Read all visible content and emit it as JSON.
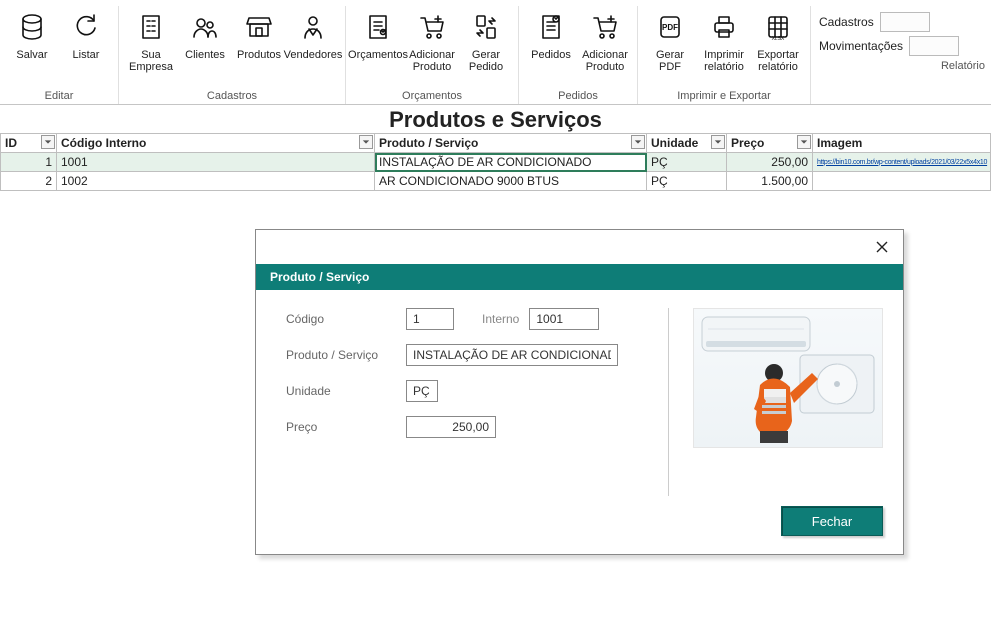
{
  "ribbon": {
    "groups": [
      {
        "label": "Editar",
        "buttons": [
          {
            "name": "salvar-button",
            "icon": "db",
            "label": "Salvar"
          },
          {
            "name": "listar-button",
            "icon": "refresh",
            "label": "Listar"
          }
        ]
      },
      {
        "label": "Cadastros",
        "buttons": [
          {
            "name": "sua-empresa-button",
            "icon": "building",
            "label": "Sua\nEmpresa"
          },
          {
            "name": "clientes-button",
            "icon": "people",
            "label": "Clientes"
          },
          {
            "name": "produtos-button",
            "icon": "store",
            "label": "Produtos"
          },
          {
            "name": "vendedores-button",
            "icon": "vendor",
            "label": "Vendedores"
          }
        ]
      },
      {
        "label": "Orçamentos",
        "buttons": [
          {
            "name": "orcamentos-button",
            "icon": "invoice",
            "label": "Orçamentos"
          },
          {
            "name": "adicionar-produto-orc-button",
            "icon": "cart-add",
            "label": "Adicionar\nProduto"
          },
          {
            "name": "gerar-pedido-button",
            "icon": "swap",
            "label": "Gerar\nPedido"
          }
        ]
      },
      {
        "label": "Pedidos",
        "buttons": [
          {
            "name": "pedidos-button",
            "icon": "order",
            "label": "Pedidos"
          },
          {
            "name": "adicionar-produto-ped-button",
            "icon": "cart-add",
            "label": "Adicionar\nProduto"
          }
        ]
      },
      {
        "label": "Imprimir e Exportar",
        "buttons": [
          {
            "name": "gerar-pdf-button",
            "icon": "pdf",
            "label": "Gerar\nPDF"
          },
          {
            "name": "imprimir-relatorio-button",
            "icon": "printer",
            "label": "Imprimir\nrelatório"
          },
          {
            "name": "exportar-relatorio-button",
            "icon": "xls",
            "label": "Exportar\nrelatório"
          }
        ]
      }
    ],
    "side": {
      "row1_label": "Cadastros",
      "row2_label": "Movimentações",
      "bottom_label": "Relatório"
    }
  },
  "page_title": "Produtos e Serviços",
  "table": {
    "headers": {
      "id": "ID",
      "codigo": "Código Interno",
      "produto": "Produto / Serviço",
      "unidade": "Unidade",
      "preco": "Preço",
      "imagem": "Imagem"
    },
    "rows": [
      {
        "id": "1",
        "codigo": "1001",
        "produto": "INSTALAÇÃO DE AR CONDICIONADO",
        "unidade": "PÇ",
        "preco": "250,00",
        "imagem": "https://bin10.com.br/wp-content/uploads/2021/03/22x5x4x10",
        "selected": true,
        "editing_col": "produto"
      },
      {
        "id": "2",
        "codigo": "1002",
        "produto": "AR CONDICIONADO 9000 BTUS",
        "unidade": "PÇ",
        "preco": "1.500,00",
        "imagem": ""
      }
    ]
  },
  "modal": {
    "header": "Produto / Serviço",
    "labels": {
      "codigo": "Código",
      "interno": "Interno",
      "produto": "Produto / Serviço",
      "unidade": "Unidade",
      "preco": "Preço"
    },
    "values": {
      "codigo": "1",
      "interno": "1001",
      "produto": "INSTALAÇÃO DE AR CONDICIONADO",
      "unidade": "PÇ",
      "preco": "250,00"
    },
    "close_button": "Fechar"
  }
}
